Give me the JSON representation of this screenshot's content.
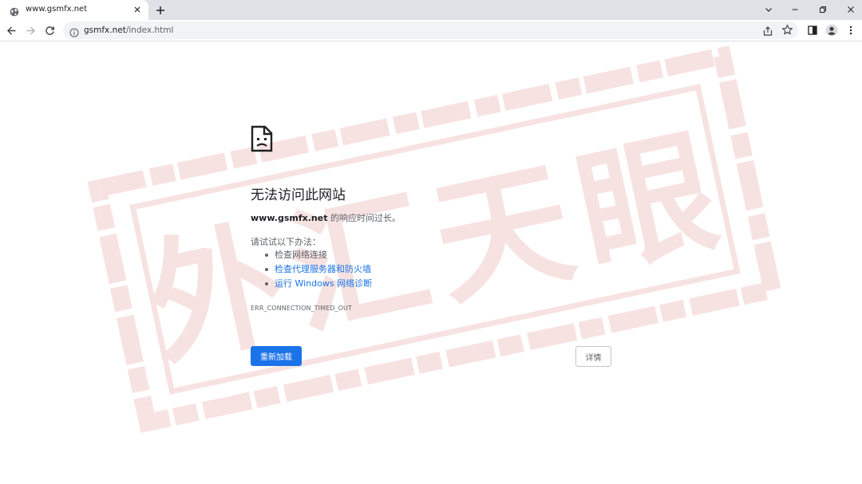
{
  "browser": {
    "tab": {
      "title": "www.gsmfx.net",
      "favicon": "globe-icon"
    },
    "address": {
      "host": "gsmfx.net",
      "path": "/index.html"
    }
  },
  "error_page": {
    "heading": "无法访问此网站",
    "summary_host": "www.gsmfx.net",
    "summary_suffix": " 的响应时间过长。",
    "try_label": "请试试以下办法：",
    "suggestions": [
      {
        "text": "检查网络连接",
        "link": false
      },
      {
        "text": "检查代理服务器和防火墙",
        "link": true
      },
      {
        "text": "运行 Windows 网络诊断",
        "link": true
      }
    ],
    "error_code": "ERR_CONNECTION_TIMED_OUT",
    "reload_label": "重新加载",
    "details_label": "详情"
  },
  "watermark": {
    "text": "外汇天眼",
    "color": "#c62828"
  },
  "colors": {
    "accent": "#1a73e8",
    "tabstrip": "#dee1e6",
    "omnibox": "#f1f3f4"
  }
}
